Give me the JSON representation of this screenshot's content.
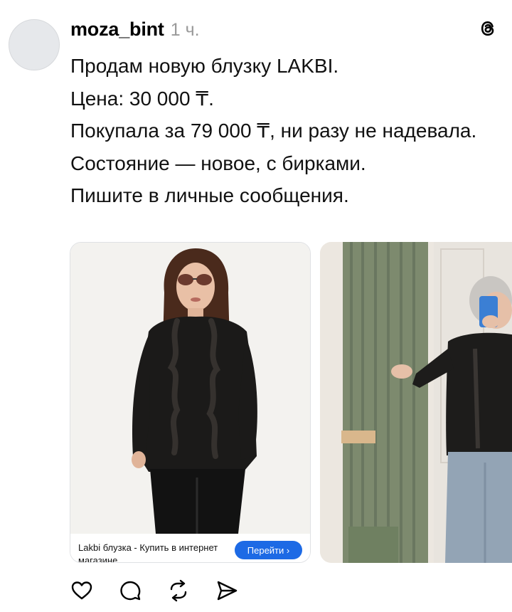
{
  "post": {
    "username": "moza_bint",
    "time": "1 ч.",
    "lines": [
      "Продам новую блузку LAKBI.",
      "Цена: 30 000 ₸.",
      "Покупала за 79 000 ₸, ни разу не надевала.",
      "Состояние — новое, с бирками.",
      "Пишите в личные сообщения."
    ]
  },
  "link_card": {
    "title": "Lakbi блузка - Купить в интернет магазине...",
    "button_label": "Перейти ›"
  },
  "icons": {
    "brand": "threads-logo",
    "actions": [
      "heart-icon",
      "comment-icon",
      "repost-icon",
      "share-icon"
    ]
  },
  "colors": {
    "button_blue": "#1d6ae5",
    "time_gray": "#9a9a9a",
    "curtain_green": "#7d8a6e"
  }
}
